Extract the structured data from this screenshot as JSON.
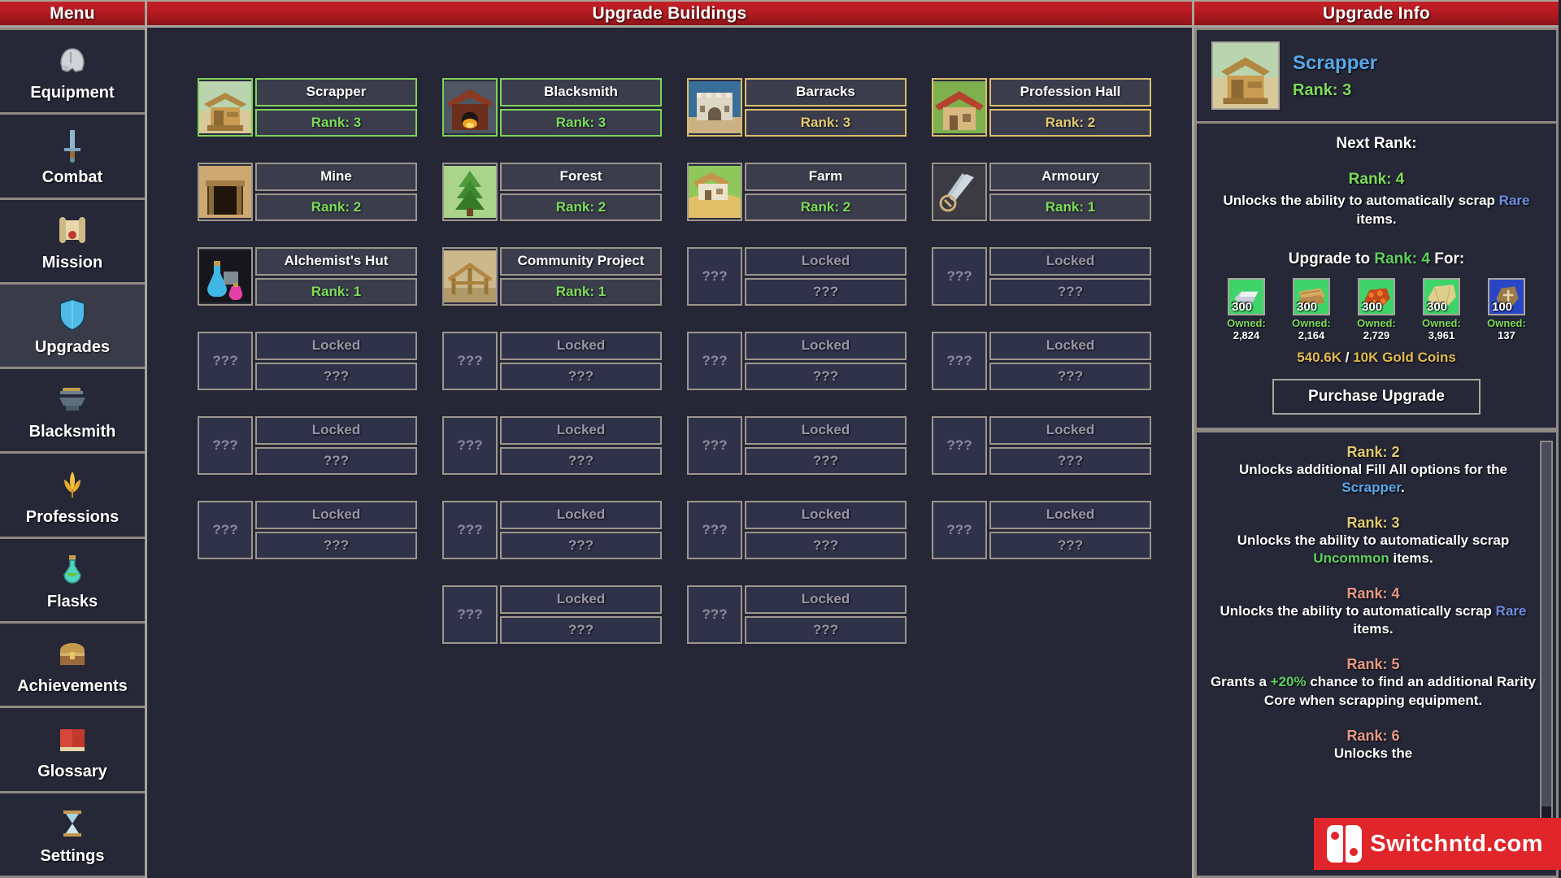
{
  "sidebar": {
    "title": "Menu",
    "items": [
      {
        "label": "Equipment",
        "icon": "helmet-icon",
        "active": false
      },
      {
        "label": "Combat",
        "icon": "sword-icon",
        "active": false
      },
      {
        "label": "Mission",
        "icon": "scroll-icon",
        "active": false
      },
      {
        "label": "Upgrades",
        "icon": "shield-icon",
        "active": true
      },
      {
        "label": "Blacksmith",
        "icon": "anvil-icon",
        "active": false
      },
      {
        "label": "Professions",
        "icon": "wheat-icon",
        "active": false
      },
      {
        "label": "Flasks",
        "icon": "flask-icon",
        "active": false
      },
      {
        "label": "Achievements",
        "icon": "chest-icon",
        "active": false
      },
      {
        "label": "Glossary",
        "icon": "book-icon",
        "active": false
      },
      {
        "label": "Settings",
        "icon": "hourglass-icon",
        "active": false
      }
    ]
  },
  "center": {
    "title": "Upgrade Buildings",
    "locked_label": "Locked",
    "unknown_label": "???",
    "buildings": [
      {
        "name": "Scrapper",
        "rank": "Rank: 3",
        "state": "green",
        "icon": "scrapper-icon"
      },
      {
        "name": "Blacksmith",
        "rank": "Rank: 3",
        "state": "green",
        "icon": "blacksmith-icon"
      },
      {
        "name": "Barracks",
        "rank": "Rank: 3",
        "state": "gold",
        "icon": "barracks-icon"
      },
      {
        "name": "Profession Hall",
        "rank": "Rank: 2",
        "state": "gold",
        "icon": "professionhall-icon"
      },
      {
        "name": "Mine",
        "rank": "Rank: 2",
        "state": "normal",
        "icon": "mine-icon"
      },
      {
        "name": "Forest",
        "rank": "Rank: 2",
        "state": "normal",
        "icon": "forest-icon"
      },
      {
        "name": "Farm",
        "rank": "Rank: 2",
        "state": "normal",
        "icon": "farm-icon"
      },
      {
        "name": "Armoury",
        "rank": "Rank: 1",
        "state": "normal",
        "icon": "armoury-icon"
      },
      {
        "name": "Alchemist's Hut",
        "rank": "Rank: 1",
        "state": "normal",
        "icon": "alchemist-icon"
      },
      {
        "name": "Community Project",
        "rank": "Rank: 1",
        "state": "normal",
        "icon": "community-icon"
      },
      {
        "name": "Locked",
        "rank": "???",
        "state": "locked",
        "icon": "locked-icon"
      },
      {
        "name": "Locked",
        "rank": "???",
        "state": "locked",
        "icon": "locked-icon"
      },
      {
        "name": "Locked",
        "rank": "???",
        "state": "locked",
        "icon": "locked-icon"
      },
      {
        "name": "Locked",
        "rank": "???",
        "state": "locked",
        "icon": "locked-icon"
      },
      {
        "name": "Locked",
        "rank": "???",
        "state": "locked",
        "icon": "locked-icon"
      },
      {
        "name": "Locked",
        "rank": "???",
        "state": "locked",
        "icon": "locked-icon"
      },
      {
        "name": "Locked",
        "rank": "???",
        "state": "locked",
        "icon": "locked-icon"
      },
      {
        "name": "Locked",
        "rank": "???",
        "state": "locked",
        "icon": "locked-icon"
      },
      {
        "name": "Locked",
        "rank": "???",
        "state": "locked",
        "icon": "locked-icon"
      },
      {
        "name": "Locked",
        "rank": "???",
        "state": "locked",
        "icon": "locked-icon"
      },
      {
        "name": "Locked",
        "rank": "???",
        "state": "locked",
        "icon": "locked-icon"
      },
      {
        "name": "Locked",
        "rank": "???",
        "state": "locked",
        "icon": "locked-icon"
      },
      {
        "name": "Locked",
        "rank": "???",
        "state": "locked",
        "icon": "locked-icon"
      },
      {
        "name": "Locked",
        "rank": "???",
        "state": "locked",
        "icon": "locked-icon"
      },
      {
        "name": "",
        "rank": "",
        "state": "empty",
        "icon": ""
      },
      {
        "name": "Locked",
        "rank": "???",
        "state": "locked",
        "icon": "locked-icon"
      },
      {
        "name": "Locked",
        "rank": "???",
        "state": "locked",
        "icon": "locked-icon"
      },
      {
        "name": "",
        "rank": "",
        "state": "empty",
        "icon": ""
      }
    ]
  },
  "right": {
    "title": "Upgrade Info",
    "building_name": "Scrapper",
    "building_rank": "Rank: 3",
    "next_rank_title": "Next Rank:",
    "next_rank_value": "Rank: 4",
    "next_rank_desc_pre": "Unlocks the ability to automatically scrap ",
    "next_rank_desc_hl": "Rare",
    "next_rank_desc_post": " items.",
    "upgrade_for_pre": "Upgrade to ",
    "upgrade_for_rank": "Rank: 4",
    "upgrade_for_post": " For:",
    "owned_label": "Owned:",
    "costs": [
      {
        "icon": "metal-ingot-icon",
        "qty": "300",
        "owned": "2,824",
        "tier": "uncommon"
      },
      {
        "icon": "wood-plank-icon",
        "qty": "300",
        "owned": "2,164",
        "tier": "uncommon"
      },
      {
        "icon": "ore-chunk-icon",
        "qty": "300",
        "owned": "2,729",
        "tier": "uncommon"
      },
      {
        "icon": "stone-slab-icon",
        "qty": "300",
        "owned": "3,961",
        "tier": "uncommon"
      },
      {
        "icon": "rune-stone-icon",
        "qty": "100",
        "owned": "137",
        "tier": "rare"
      }
    ],
    "gold_current": "540.6K",
    "gold_required": "10K Gold Coins",
    "purchase_label": "Purchase Upgrade",
    "ranks": [
      {
        "head": "Rank: 2",
        "head_color": "gold",
        "parts": [
          {
            "text": "Unlocks additional Fill All options for the ",
            "color": "white"
          },
          {
            "text": "Scrapper",
            "color": "cyan"
          },
          {
            "text": ".",
            "color": "white"
          }
        ]
      },
      {
        "head": "Rank: 3",
        "head_color": "gold",
        "parts": [
          {
            "text": "Unlocks the ability to automatically scrap ",
            "color": "white"
          },
          {
            "text": "Uncommon",
            "color": "green"
          },
          {
            "text": " items.",
            "color": "white"
          }
        ]
      },
      {
        "head": "Rank: 4",
        "head_color": "salmon",
        "parts": [
          {
            "text": "Unlocks the ability to automatically scrap ",
            "color": "white"
          },
          {
            "text": "Rare",
            "color": "blue"
          },
          {
            "text": " items.",
            "color": "white"
          }
        ]
      },
      {
        "head": "Rank: 5",
        "head_color": "salmon",
        "parts": [
          {
            "text": "Grants a ",
            "color": "white"
          },
          {
            "text": "+20%",
            "color": "green"
          },
          {
            "text": " chance to find an additional Rarity Core when scrapping equipment.",
            "color": "white"
          }
        ]
      },
      {
        "head": "Rank: 6",
        "head_color": "salmon",
        "parts": [
          {
            "text": "Unlocks the",
            "color": "white"
          }
        ]
      }
    ]
  },
  "watermark": {
    "text": "Switchntd.com"
  }
}
